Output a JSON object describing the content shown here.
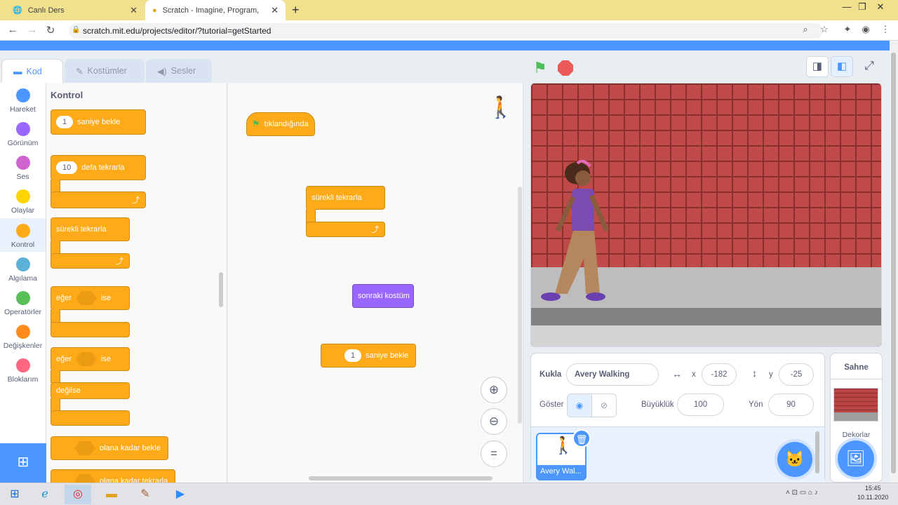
{
  "browser": {
    "tabs": [
      {
        "title": "Canlı Ders"
      },
      {
        "title": "Scratch - Imagine, Program, Shar"
      }
    ],
    "url": "scratch.mit.edu/projects/editor/?tutorial=getStarted"
  },
  "editor_tabs": [
    {
      "label": "Kod"
    },
    {
      "label": "Kostümler"
    },
    {
      "label": "Sesler"
    }
  ],
  "categories": [
    {
      "label": "Hareket",
      "color": "#4c97ff"
    },
    {
      "label": "Görünüm",
      "color": "#9966ff"
    },
    {
      "label": "Ses",
      "color": "#cf63cf"
    },
    {
      "label": "Olaylar",
      "color": "#ffd500"
    },
    {
      "label": "Kontrol",
      "color": "#ffab19"
    },
    {
      "label": "Algılama",
      "color": "#5cb1d6"
    },
    {
      "label": "Operatörler",
      "color": "#59c059"
    },
    {
      "label": "Değişkenler",
      "color": "#ff8c1a"
    },
    {
      "label": "Bloklarım",
      "color": "#ff6680"
    }
  ],
  "palette": {
    "heading": "Kontrol",
    "wait": {
      "value": "1",
      "label": "saniye bekle"
    },
    "repeat": {
      "value": "10",
      "label": "defa tekrarla"
    },
    "forever": "sürekli tekrarla",
    "if_then": {
      "if": "eğer",
      "then": "ise"
    },
    "if_else": {
      "if": "eğer",
      "then": "ise",
      "else": "değilse"
    },
    "wait_until": "olana kadar bekle",
    "repeat_until": "olana kadar tekrarla"
  },
  "workspace": {
    "hat": "tıklandığında",
    "forever": "sürekli tekrarla",
    "next_costume": "sonraki kostüm",
    "wait": {
      "value": "1",
      "label": "saniye bekle"
    }
  },
  "sprite": {
    "label": "Kukla",
    "name": "Avery Walking",
    "x_label": "x",
    "x": "-182",
    "y_label": "y",
    "y": "-25",
    "show_label": "Göster",
    "size_label": "Büyüklük",
    "size": "100",
    "direction_label": "Yön",
    "direction": "90",
    "thumb_name": "Avery Wal..."
  },
  "stage_pane": {
    "title": "Sahne",
    "backdrops_label": "Dekorlar"
  },
  "taskbar": {
    "time": "15:45",
    "date": "10.11.2020"
  },
  "colors": {
    "accent": "#4c97ff",
    "control": "#ffab19",
    "looks": "#9966ff",
    "brick": "#c04a4a"
  }
}
